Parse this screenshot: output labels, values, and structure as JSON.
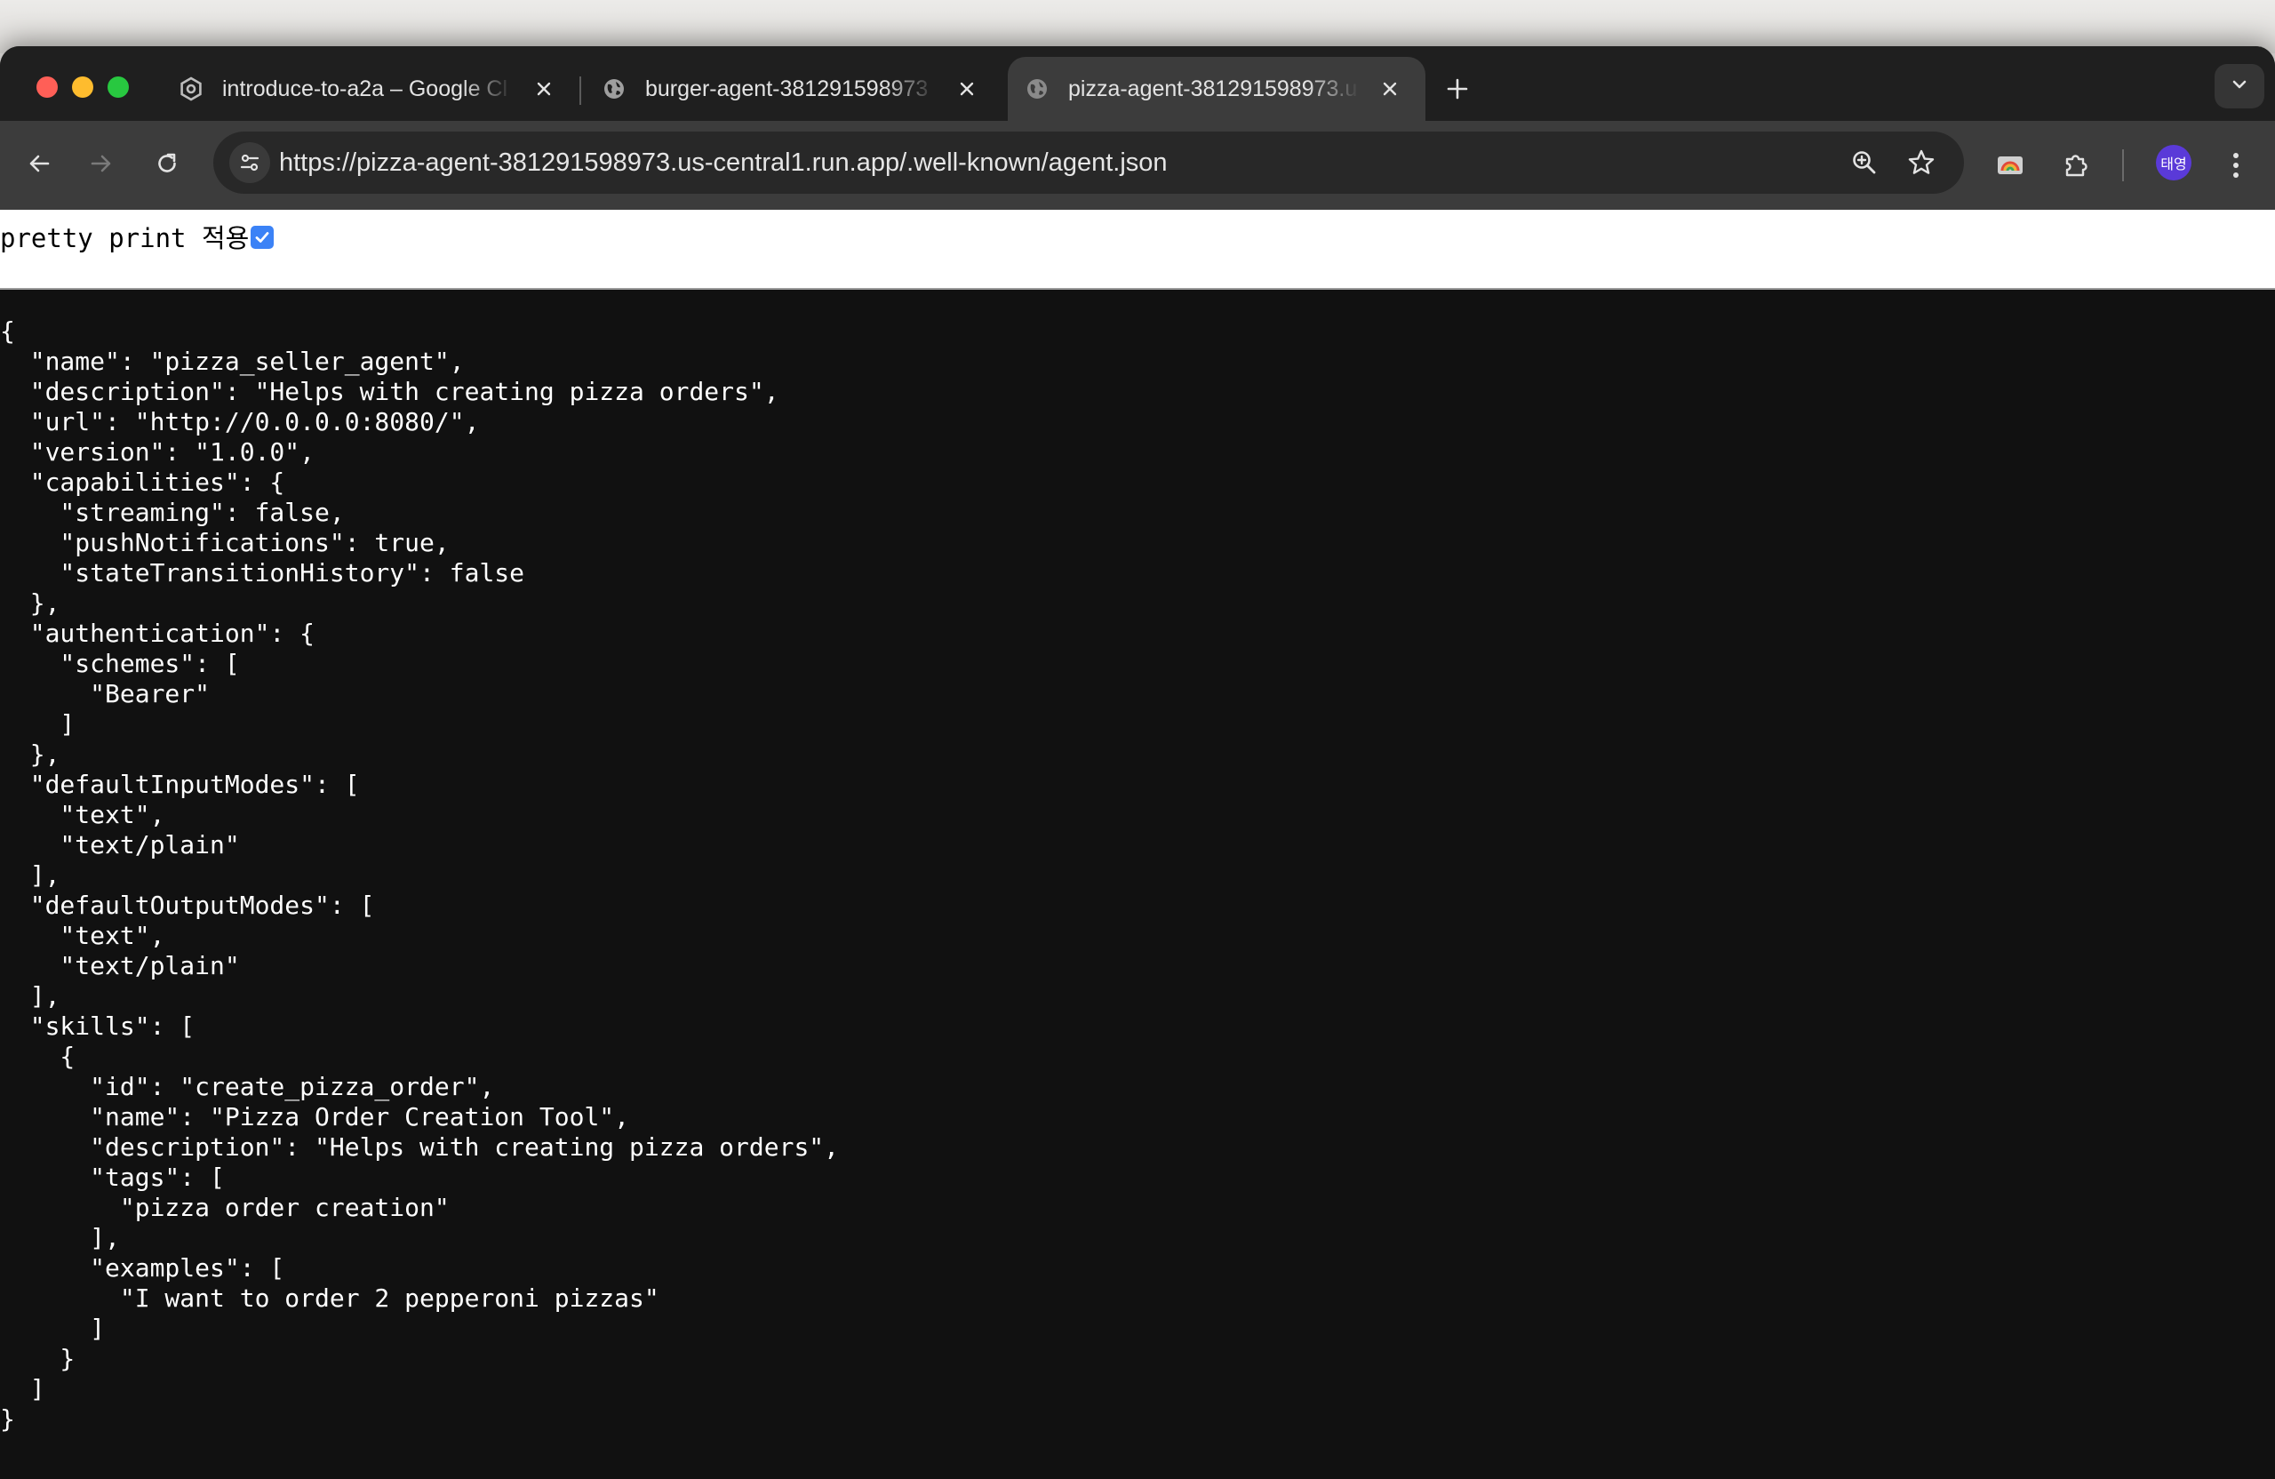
{
  "browser": {
    "tabs": [
      {
        "title": "introduce-to-a2a – Google Cl",
        "favicon": "google-cloud-icon",
        "active": false
      },
      {
        "title": "burger-agent-381291598973",
        "favicon": "globe-icon",
        "active": false
      },
      {
        "title": "pizza-agent-381291598973.u",
        "favicon": "globe-icon",
        "active": true
      }
    ],
    "url": "https://pizza-agent-381291598973.us-central1.run.app/.well-known/agent.json",
    "profile_initials": "태영",
    "accent": "#5a3ad8"
  },
  "page": {
    "pretty_print_label": "pretty print 적용",
    "pretty_print_checked": true,
    "json_text": "{\n  \"name\": \"pizza_seller_agent\",\n  \"description\": \"Helps with creating pizza orders\",\n  \"url\": \"http://0.0.0.0:8080/\",\n  \"version\": \"1.0.0\",\n  \"capabilities\": {\n    \"streaming\": false,\n    \"pushNotifications\": true,\n    \"stateTransitionHistory\": false\n  },\n  \"authentication\": {\n    \"schemes\": [\n      \"Bearer\"\n    ]\n  },\n  \"defaultInputModes\": [\n    \"text\",\n    \"text/plain\"\n  ],\n  \"defaultOutputModes\": [\n    \"text\",\n    \"text/plain\"\n  ],\n  \"skills\": [\n    {\n      \"id\": \"create_pizza_order\",\n      \"name\": \"Pizza Order Creation Tool\",\n      \"description\": \"Helps with creating pizza orders\",\n      \"tags\": [\n        \"pizza order creation\"\n      ],\n      \"examples\": [\n        \"I want to order 2 pepperoni pizzas\"\n      ]\n    }\n  ]\n}"
  }
}
